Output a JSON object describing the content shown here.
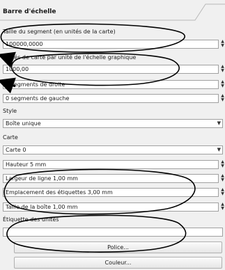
{
  "panel": {
    "title": "Barre d'échelle"
  },
  "fields": {
    "segment_size_label": "Taille du segment (en unités de la carte)",
    "segment_size_value": "100000,0000",
    "map_units_label": "Unités de carte par unité de l'échelle graphique",
    "map_units_value": "1000,00",
    "right_segments_value": "2 segments de droite",
    "left_segments_value": "0 segments de gauche",
    "style_label": "Style",
    "style_value": "Boîte unique",
    "map_label": "Carte",
    "map_value": "Carte 0",
    "height_value": "Hauteur 5 mm",
    "line_width_value": "Largeur de ligne 1,00 mm",
    "label_spacing_value": "Emplacement des étiquettes 3,00 mm",
    "box_size_value": "Taille de la boîte 1,00 mm",
    "units_label_label": "Étiquette des unités",
    "units_label_value": ""
  },
  "buttons": {
    "font": "Police...",
    "color": "Couleur..."
  },
  "icons": {
    "spin_up": "▲",
    "spin_down": "▼",
    "dropdown": "▼"
  },
  "annotation_colors": {
    "ink": "#000000"
  }
}
